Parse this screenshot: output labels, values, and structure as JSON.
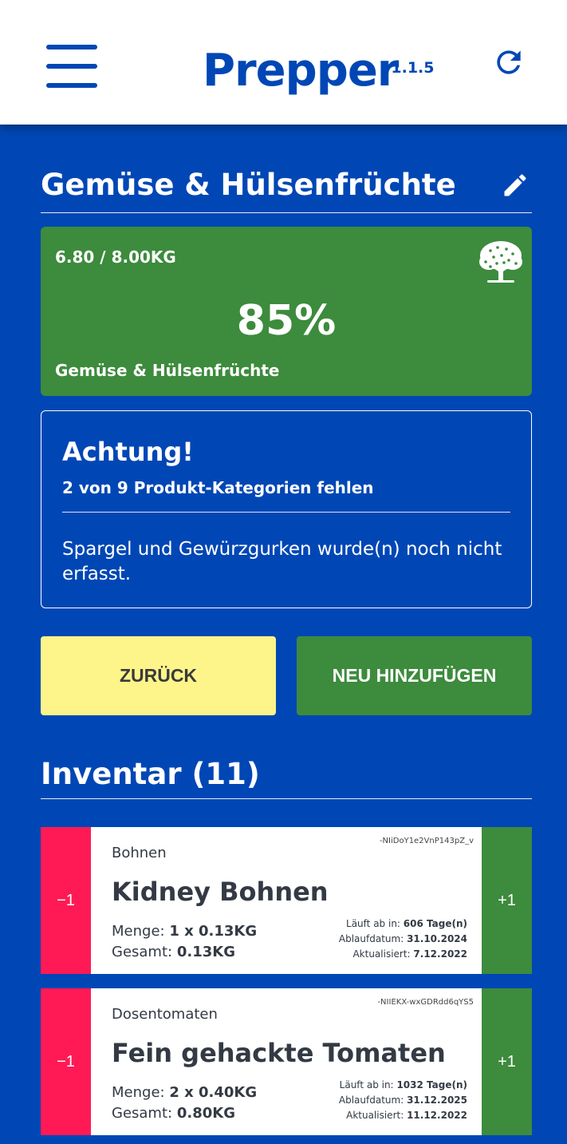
{
  "header": {
    "title": "Prepper",
    "version": "v1.1.5",
    "menu_icon": "hamburger-menu-icon",
    "refresh_icon": "refresh-icon"
  },
  "category": {
    "title": "Gemüse & Hülsenfrüchte",
    "edit_icon": "pencil-icon"
  },
  "progress": {
    "amount": "6.80 / 8.00KG",
    "percent": "85%",
    "label": "Gemüse & Hülsenfrüchte",
    "icon": "tree-icon",
    "color": "#3d8b3d"
  },
  "alert": {
    "title": "Achtung!",
    "subtitle": "2 von 9 Produkt-Kategorien fehlen",
    "message": "Spargel und Gewürzgurken wurde(n) noch nicht erfasst."
  },
  "buttons": {
    "back": "ZURÜCK",
    "add": "NEU HINZUFÜGEN"
  },
  "inventory": {
    "title": "Inventar (11)",
    "items": [
      {
        "id": "-NIiDoY1e2VnP143pZ_v",
        "category": "Bohnen",
        "name": "Kidney Bohnen",
        "menge_label": "Menge:",
        "menge_value": "1 x 0.13KG",
        "gesamt_label": "Gesamt:",
        "gesamt_value": "0.13KG",
        "laeuft_label": "Läuft ab in:",
        "laeuft_value": "606 Tage(n)",
        "ablauf_label": "Ablaufdatum:",
        "ablauf_value": "31.10.2024",
        "aktualisiert_label": "Aktualisiert:",
        "aktualisiert_value": "7.12.2022",
        "minus": "−1",
        "plus": "+1"
      },
      {
        "id": "-NIIEKX-wxGDRdd6qYS5",
        "category": "Dosentomaten",
        "name": "Fein gehackte Tomaten",
        "menge_label": "Menge:",
        "menge_value": "2 x 0.40KG",
        "gesamt_label": "Gesamt:",
        "gesamt_value": "0.80KG",
        "laeuft_label": "Läuft ab in:",
        "laeuft_value": "1032 Tage(n)",
        "ablauf_label": "Ablaufdatum:",
        "ablauf_value": "31.12.2025",
        "aktualisiert_label": "Aktualisiert:",
        "aktualisiert_value": "11.12.2022",
        "minus": "−1",
        "plus": "+1"
      }
    ]
  },
  "colors": {
    "primary": "#0047b5",
    "success": "#3d8b3d",
    "danger": "#ff1a55",
    "warning": "#fdf58a"
  }
}
